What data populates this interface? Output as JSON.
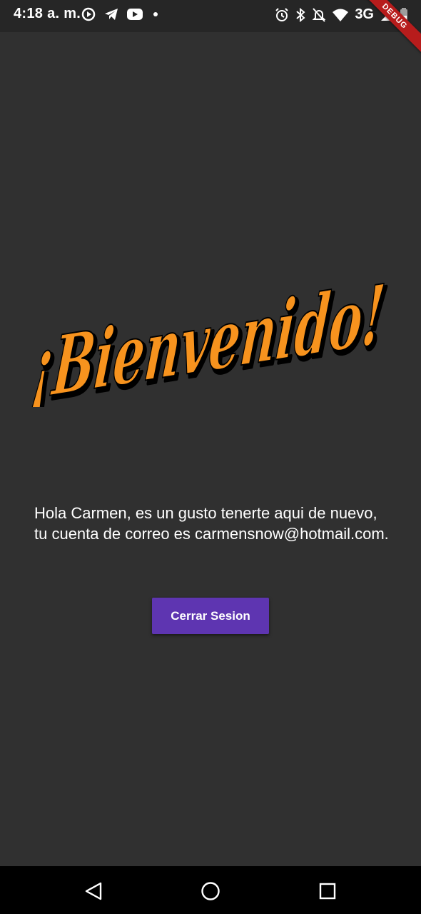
{
  "status_bar": {
    "time": "4:18 a. m.",
    "network": "3G",
    "left_icons": [
      "screen-record-icon",
      "telegram-icon",
      "youtube-icon",
      "notification-dot-icon"
    ],
    "right_icons": [
      "alarm-icon",
      "bluetooth-icon",
      "notifications-off-icon",
      "wifi-icon",
      "signal-icon",
      "battery-icon"
    ]
  },
  "debug_banner": "DEBUG",
  "welcome": {
    "heading": "¡Bienvenido!",
    "colors": {
      "text": "#f7931e",
      "shadow": "#000000"
    }
  },
  "message": "Hola Carmen, es un gusto tenerte aqui de nuevo, tu cuenta de correo es carmensnow@hotmail.com.",
  "logout_button": {
    "label": "Cerrar Sesion",
    "color": "#5e35b1"
  },
  "nav_bar": {
    "icons": [
      "back-icon",
      "home-icon",
      "recents-icon"
    ]
  },
  "theme": {
    "background": "#303030",
    "status_bar": "#262626"
  }
}
